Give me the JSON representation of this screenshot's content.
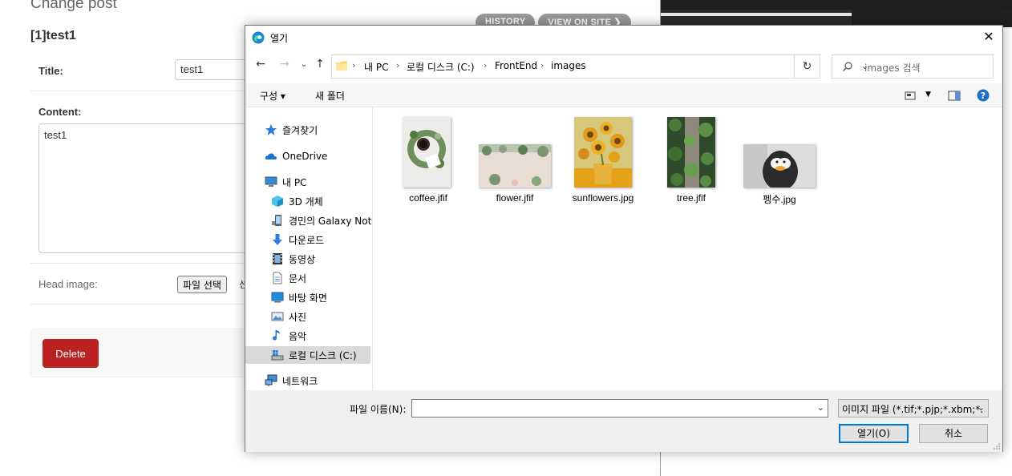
{
  "admin": {
    "page_title": "Change post",
    "history_label": "HISTORY",
    "view_on_site_label": "VIEW ON SITE ❯",
    "object_name": "[1]test1",
    "title_label": "Title:",
    "title_value": "test1",
    "content_label": "Content:",
    "content_value": "test1",
    "head_image_label": "Head image:",
    "file_button_label": "파일 선택",
    "file_button_rest": "선",
    "delete_label": "Delete"
  },
  "dialog": {
    "title": "열기",
    "breadcrumbs": [
      "내 PC",
      "로컬 디스크 (C:)",
      "FrontEnd",
      "images"
    ],
    "search_placeholder": "images 검색",
    "toolbar": {
      "organize": "구성 ▾",
      "new_folder": "새 폴더"
    },
    "sidebar": [
      {
        "label": "즐겨찾기",
        "icon": "star-icon"
      },
      {
        "label": "OneDrive",
        "icon": "cloud-icon"
      },
      {
        "label": "내 PC",
        "icon": "computer-icon"
      },
      {
        "label": "3D 개체",
        "icon": "cube-icon"
      },
      {
        "label": "경민의 Galaxy Note",
        "icon": "phone-icon"
      },
      {
        "label": "다운로드",
        "icon": "download-icon"
      },
      {
        "label": "동영상",
        "icon": "video-icon"
      },
      {
        "label": "문서",
        "icon": "document-icon"
      },
      {
        "label": "바탕 화면",
        "icon": "desktop-icon"
      },
      {
        "label": "사진",
        "icon": "picture-icon"
      },
      {
        "label": "음악",
        "icon": "music-icon"
      },
      {
        "label": "로컬 디스크 (C:)",
        "icon": "drive-icon"
      },
      {
        "label": "네트워크",
        "icon": "network-icon"
      }
    ],
    "files": [
      {
        "name": "coffee.jfif"
      },
      {
        "name": "flower.jfif"
      },
      {
        "name": "sunflowers.jpg"
      },
      {
        "name": "tree.jfif"
      },
      {
        "name": "펭수.jpg"
      }
    ],
    "filename_label": "파일 이름(N):",
    "filename_value": "",
    "filetype_value": "이미지 파일 (*.tif;*.pjp;*.xbm;*.",
    "open_label": "열기(O)",
    "cancel_label": "취소"
  }
}
